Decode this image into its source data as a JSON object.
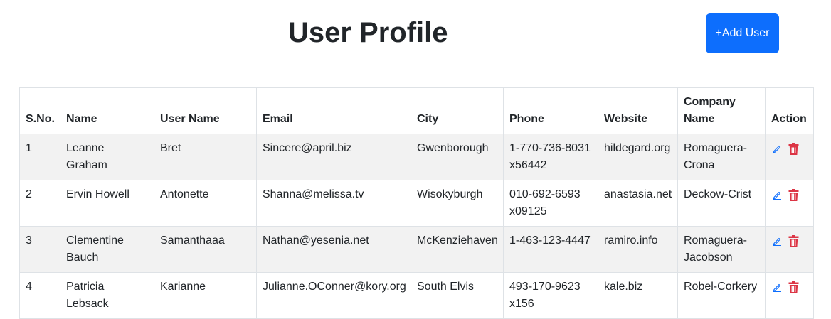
{
  "header": {
    "title": "User Profile",
    "add_button_label": "+Add User"
  },
  "table": {
    "columns": [
      "S.No.",
      "Name",
      "User Name",
      "Email",
      "City",
      "Phone",
      "Website",
      "Company Name",
      "Action"
    ],
    "rows": [
      {
        "sno": "1",
        "name": "Leanne Graham",
        "username": "Bret",
        "email": "Sincere@april.biz",
        "city": "Gwenborough",
        "phone": "1-770-736-8031 x56442",
        "website": "hildegard.org",
        "company": "Romaguera-Crona"
      },
      {
        "sno": "2",
        "name": "Ervin Howell",
        "username": "Antonette",
        "email": "Shanna@melissa.tv",
        "city": "Wisokyburgh",
        "phone": "010-692-6593 x09125",
        "website": "anastasia.net",
        "company": "Deckow-Crist"
      },
      {
        "sno": "3",
        "name": "Clementine Bauch",
        "username": "Samanthaaa",
        "email": "Nathan@yesenia.net",
        "city": "McKenziehaven",
        "phone": "1-463-123-4447",
        "website": "ramiro.info",
        "company": "Romaguera-Jacobson"
      },
      {
        "sno": "4",
        "name": "Patricia Lebsack",
        "username": "Karianne",
        "email": "Julianne.OConner@kory.org",
        "city": "South Elvis",
        "phone": "493-170-9623 x156",
        "website": "kale.biz",
        "company": "Robel-Corkery"
      }
    ],
    "action_icons": {
      "edit": "edit-icon",
      "delete": "trash-icon"
    }
  },
  "colors": {
    "primary": "#0d6efd",
    "edit": "#0d6efd",
    "delete": "#dc3545",
    "stripe": "#f2f2f2"
  }
}
